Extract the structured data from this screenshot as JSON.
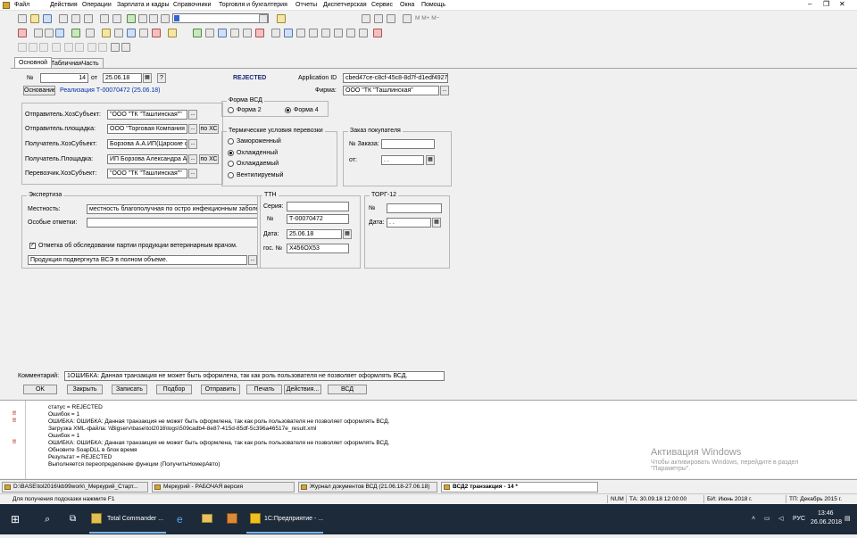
{
  "menu": [
    "Файл",
    "Действия",
    "Операции",
    "Зарплата и кадры",
    "Справочники",
    "Торговля и бухгалтерия",
    "Отчеты",
    "Диспетчерская",
    "Сервис",
    "Окна",
    "Помощь"
  ],
  "tabs": [
    "Основной",
    "ТабличнаяЧасть"
  ],
  "header": {
    "num_label": "№",
    "num_value": "14",
    "from_label": "от",
    "date_value": "25.06.18",
    "question": "?",
    "status": "REJECTED",
    "app_id_label": "Application ID",
    "app_id_value": "cbed47ce-c8cf-45c8-8d7f-d1edf49273fd",
    "firm_label": "Фирма:",
    "firm_value": "ООО \"ТК \"Ташлинская\"",
    "basis_btn": "Основание",
    "basis_link": "Реализация Т-00070472 (25.06.18)"
  },
  "parties": {
    "sender_subj_label": "Отправитель.ХозСубъект:",
    "sender_subj_value": "\"ООО \"ТК \"Ташлинская\"\"",
    "sender_site_label": "Отправитель.площадка:",
    "sender_site_value": "ООО \"Торговая Компания \"Та",
    "recv_subj_label": "Получатель.ХозСубъект:",
    "recv_subj_value": "Борзова А.А.ИП(Царские обед",
    "recv_site_label": "Получатель.Площадка:",
    "recv_site_value": "ИП Борзова Александра Андре",
    "carrier_label": "Перевозчик.ХозСубъект:",
    "carrier_value": "\"ООО \"ТК \"Ташлинская\"\"",
    "by_hs": "по ХС"
  },
  "vsd_form": {
    "title": "Форма ВСД",
    "opt1": "Форма 2",
    "opt2": "Форма 4"
  },
  "thermal": {
    "title": "Термические условия перевозки",
    "opts": [
      "Замороженный",
      "Охлажденный",
      "Охлаждаемый",
      "Вентилируемый"
    ]
  },
  "order": {
    "title": "Заказ покупателя",
    "num_label": "№ Заказа:",
    "from_label": "от:",
    "date_value": ". ."
  },
  "expertise": {
    "title": "Экспертиза",
    "place_label": "Местность:",
    "place_value": "местность благополучная по остро инфекционным заболевани",
    "notes_label": "Особые отметки:",
    "check_label": "Отметка об обследовании партии продукции ветеринарным врачом.",
    "product_value": "Продукция подвергнута ВСЭ в полном объеме."
  },
  "ttn": {
    "title": "ТТН",
    "series_label": "Серия:",
    "num_label": "№",
    "num_value": "Т-00070472",
    "date_label": "Дата:",
    "date_value": "25.06.18",
    "gos_label": "гос. №",
    "gos_value": "Х456ОХ53"
  },
  "torg": {
    "title": "ТОРГ-12",
    "num_label": "№",
    "date_label": "Дата:",
    "date_value": ". ."
  },
  "comment": {
    "label": "Комментарий:",
    "value": "1ОШИБКА: Данная транзакция не может быть оформлена, так как роль пользователя не позволяет оформлять ВСД."
  },
  "buttons": [
    "OK",
    "Закрыть",
    "Записать",
    "Подбор",
    "Отправить",
    "Печать",
    "Действия...",
    "ВСД"
  ],
  "log": [
    {
      "mark": "",
      "text": "статус = REJECTED"
    },
    {
      "mark": "!!",
      "text": "Ошибок = 1"
    },
    {
      "mark": "!!",
      "text": "ОШИБКА: ОШИБКА: Данная транзакция не может быть оформлена, так как роль пользователя не позволяет оформлять ВСД."
    },
    {
      "mark": "",
      "text": "Загрузка XML-файла: \\\\Bigserv\\base\\tol2016\\logs\\509cadb4-8e87-415d-85df-5c396a46517e_result.xml"
    },
    {
      "mark": "",
      "text": "Ошибок = 1"
    },
    {
      "mark": "!!",
      "text": "ОШИБКА: ОШИБКА: Данная транзакция не может быть оформлена, так как роль пользователя не позволяет оформлять ВСД."
    },
    {
      "mark": "",
      "text": "Обновите SoapDLL в блок время"
    },
    {
      "mark": "",
      "text": "Результат = REJECTED"
    },
    {
      "mark": "",
      "text": "Выполняется переопределение функции (ПолучитьНомерАвто)"
    }
  ],
  "watermark": {
    "title": "Активация Windows",
    "sub": "Чтобы активировать Windows, перейдите в раздел",
    "sub2": "\"Параметры\"."
  },
  "windows": [
    "D:\\BASE\\tol2016\\kb99work\\_Меркурий_Старт...",
    "Меркурий - РАБОЧАЯ версия",
    "Журнал документов ВСД (21.06.18-27.06.18)",
    "ВСД2 транзакция - 14 *"
  ],
  "status": {
    "hint": "Для получения подсказки нажмите F1",
    "num": "NUM",
    "ta": "ТА: 30.09.18 12:00:00",
    "bi": "БИ: Июнь 2018 г.",
    "tp": "ТП: Декабрь 2015 г."
  },
  "taskbar": {
    "app1": "Total Commander ...",
    "app2": "1С:Предприятие - ...",
    "lang": "РУС",
    "time": "13:46",
    "date": "26.06.2018"
  }
}
